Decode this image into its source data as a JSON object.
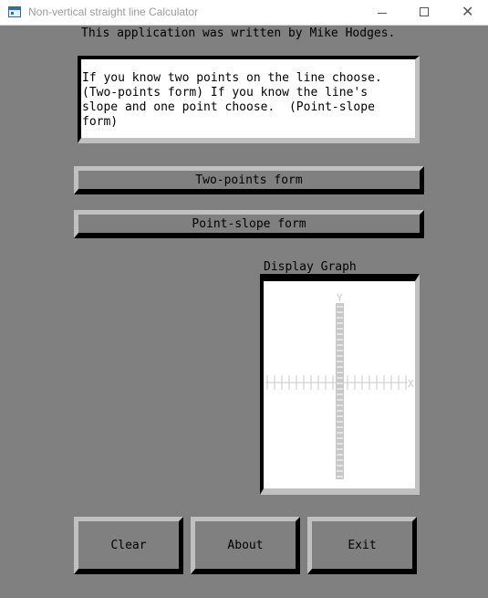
{
  "window": {
    "title": "Non-vertical straight line Calculator",
    "minimize_glyph": "—",
    "maximize_glyph": "☐",
    "close_glyph": "✕"
  },
  "author_text": "This application was written by Mike Hodges.",
  "instructions": "If you know two points on the line choose.\n(Two-points form) If you know the line's\nslope and one point choose.  (Point-slope\nform)",
  "buttons": {
    "two_points": "Two-points form",
    "point_slope": "Point-slope form",
    "clear": "Clear",
    "about": "About",
    "exit": "Exit"
  },
  "graph": {
    "label": "Display Graph",
    "x_axis_label": "X",
    "y_axis_label": "Y"
  },
  "colors": {
    "background": "#808080",
    "bevel_light": "#c0c0c0",
    "bevel_dark": "#000000",
    "axis": "#c8c8c8"
  }
}
